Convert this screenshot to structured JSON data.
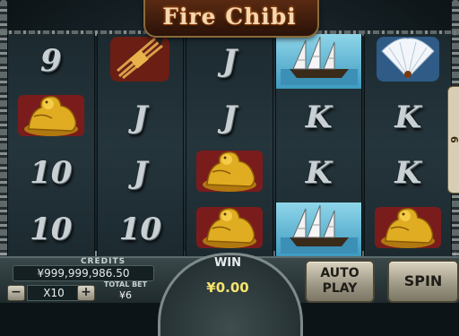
{
  "game": {
    "title": "Fire Chibi"
  },
  "reels": [
    [
      {
        "type": "letter",
        "label": "9"
      },
      {
        "type": "icon",
        "icon": "golden-lion-icon"
      },
      {
        "type": "letter",
        "label": "10"
      },
      {
        "type": "letter",
        "label": "10"
      }
    ],
    [
      {
        "type": "icon",
        "icon": "arrow-bundle-icon"
      },
      {
        "type": "letter",
        "label": "J"
      },
      {
        "type": "letter",
        "label": "J"
      },
      {
        "type": "letter",
        "label": "10"
      }
    ],
    [
      {
        "type": "letter",
        "label": "J"
      },
      {
        "type": "letter",
        "label": "J"
      },
      {
        "type": "icon",
        "icon": "golden-lion-icon"
      },
      {
        "type": "icon",
        "icon": "golden-lion-icon"
      }
    ],
    [
      {
        "type": "icon",
        "icon": "junk-ship-icon",
        "highlight": true
      },
      {
        "type": "letter",
        "label": "K"
      },
      {
        "type": "letter",
        "label": "K"
      },
      {
        "type": "icon",
        "icon": "junk-ship-icon",
        "highlight": true
      }
    ],
    [
      {
        "type": "icon",
        "icon": "feather-fan-icon"
      },
      {
        "type": "letter",
        "label": "K"
      },
      {
        "type": "letter",
        "label": "K"
      },
      {
        "type": "icon",
        "icon": "golden-lion-icon"
      }
    ]
  ],
  "side_tab": {
    "text": "6"
  },
  "credits": {
    "label": "CREDITS",
    "value": "¥999,999,986.50"
  },
  "lines": {
    "minus": "−",
    "plus": "+",
    "value": "X10"
  },
  "total_bet": {
    "label": "TOTAL BET",
    "value": "¥6"
  },
  "win": {
    "label": "WIN",
    "value": "¥0.00"
  },
  "buttons": {
    "auto_play_1": "AUTO",
    "auto_play_2": "PLAY",
    "spin": "SPIN"
  },
  "colors": {
    "win_highlight": "#6cc3df",
    "gold": "#d9a520",
    "lion_bg": "#8a1e1e"
  }
}
